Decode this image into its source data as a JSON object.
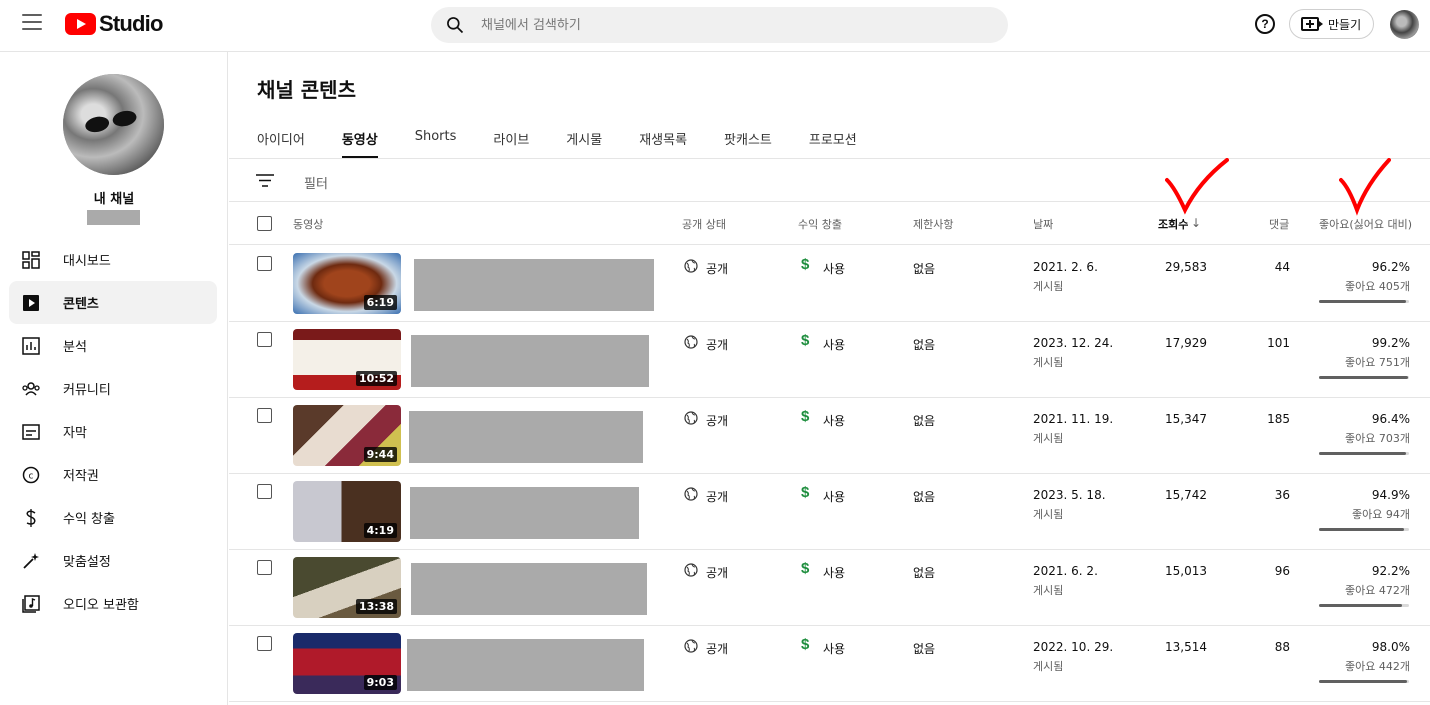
{
  "header": {
    "logo_text": "Studio",
    "search_placeholder": "채널에서 검색하기",
    "help_label": "?",
    "create_label": "만들기"
  },
  "sidebar": {
    "channel_label": "내 채널",
    "items": [
      {
        "label": "대시보드",
        "icon": "dashboard-icon"
      },
      {
        "label": "콘텐츠",
        "icon": "content-icon",
        "active": true
      },
      {
        "label": "분석",
        "icon": "analytics-icon"
      },
      {
        "label": "커뮤니티",
        "icon": "community-icon"
      },
      {
        "label": "자막",
        "icon": "subtitles-icon"
      },
      {
        "label": "저작권",
        "icon": "copyright-icon"
      },
      {
        "label": "수익 창출",
        "icon": "monetization-icon"
      },
      {
        "label": "맞춤설정",
        "icon": "customization-icon"
      },
      {
        "label": "오디오 보관함",
        "icon": "audio-library-icon"
      }
    ]
  },
  "main": {
    "title": "채널 콘텐츠",
    "tabs": [
      {
        "label": "아이디어"
      },
      {
        "label": "동영상",
        "active": true
      },
      {
        "label": "Shorts"
      },
      {
        "label": "라이브"
      },
      {
        "label": "게시물"
      },
      {
        "label": "재생목록"
      },
      {
        "label": "팟캐스트"
      },
      {
        "label": "프로모션"
      }
    ],
    "filter_label": "필터",
    "columns": {
      "video": "동영상",
      "visibility": "공개 상태",
      "monetization": "수익 창출",
      "restrictions": "제한사항",
      "date": "날짜",
      "views": "조회수",
      "comments": "댓글",
      "likes": "좋아요(싫어요 대비)"
    },
    "accent_color": "#ff0000",
    "money_color": "#1e8e3e",
    "rows": [
      {
        "duration": "6:19",
        "visibility": "공개",
        "monetization": "사용",
        "restrictions": "없음",
        "date": "2021. 2. 6.",
        "date_status": "게시됨",
        "views": "29,583",
        "comments": "44",
        "like_pct": "96.2%",
        "like_count": "좋아요 405개",
        "like_ratio": 0.962
      },
      {
        "duration": "10:52",
        "visibility": "공개",
        "monetization": "사용",
        "restrictions": "없음",
        "date": "2023. 12. 24.",
        "date_status": "게시됨",
        "views": "17,929",
        "comments": "101",
        "like_pct": "99.2%",
        "like_count": "좋아요 751개",
        "like_ratio": 0.992
      },
      {
        "duration": "9:44",
        "visibility": "공개",
        "monetization": "사용",
        "restrictions": "없음",
        "date": "2021. 11. 19.",
        "date_status": "게시됨",
        "views": "15,347",
        "comments": "185",
        "like_pct": "96.4%",
        "like_count": "좋아요 703개",
        "like_ratio": 0.964
      },
      {
        "duration": "4:19",
        "visibility": "공개",
        "monetization": "사용",
        "restrictions": "없음",
        "date": "2023. 5. 18.",
        "date_status": "게시됨",
        "views": "15,742",
        "comments": "36",
        "like_pct": "94.9%",
        "like_count": "좋아요 94개",
        "like_ratio": 0.949
      },
      {
        "duration": "13:38",
        "visibility": "공개",
        "monetization": "사용",
        "restrictions": "없음",
        "date": "2021. 6. 2.",
        "date_status": "게시됨",
        "views": "15,013",
        "comments": "96",
        "like_pct": "92.2%",
        "like_count": "좋아요 472개",
        "like_ratio": 0.922
      },
      {
        "duration": "9:03",
        "visibility": "공개",
        "monetization": "사용",
        "restrictions": "없음",
        "date": "2022. 10. 29.",
        "date_status": "게시됨",
        "views": "13,514",
        "comments": "88",
        "like_pct": "98.0%",
        "like_count": "좋아요 442개",
        "like_ratio": 0.98
      }
    ]
  }
}
